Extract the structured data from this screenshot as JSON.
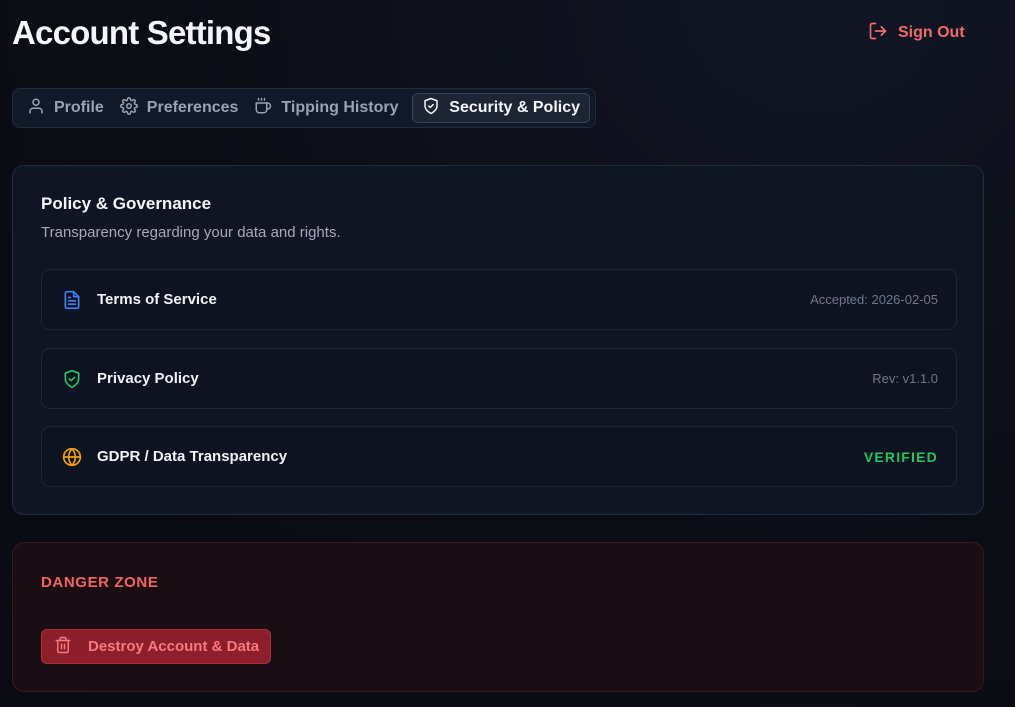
{
  "header": {
    "title": "Account Settings",
    "sign_out_label": "Sign Out"
  },
  "tabs": [
    {
      "label": "Profile",
      "icon": "user-icon",
      "active": false
    },
    {
      "label": "Preferences",
      "icon": "gear-icon",
      "active": false
    },
    {
      "label": "Tipping History",
      "icon": "coffee-cup-icon",
      "active": false
    },
    {
      "label": "Security & Policy",
      "icon": "shield-icon",
      "active": true
    }
  ],
  "policy": {
    "title": "Policy & Governance",
    "subtitle": "Transparency regarding your data and rights.",
    "items": [
      {
        "label": "Terms of Service",
        "meta": "Accepted: 2026-02-05",
        "icon": "document-icon",
        "icon_color": "#3b82f6"
      },
      {
        "label": "Privacy Policy",
        "meta": "Rev: v1.1.0",
        "icon": "shield-check-icon",
        "icon_color": "#22c55e"
      },
      {
        "label": "GDPR / Data Transparency",
        "meta": "VERIFIED",
        "icon": "globe-icon",
        "icon_color": "#f59e0b"
      }
    ]
  },
  "danger_zone": {
    "title": "DANGER ZONE",
    "button_label": "Destroy Account & Data"
  },
  "colors": {
    "accent_danger": "#ef6b6b",
    "verified": "#22c55e"
  }
}
